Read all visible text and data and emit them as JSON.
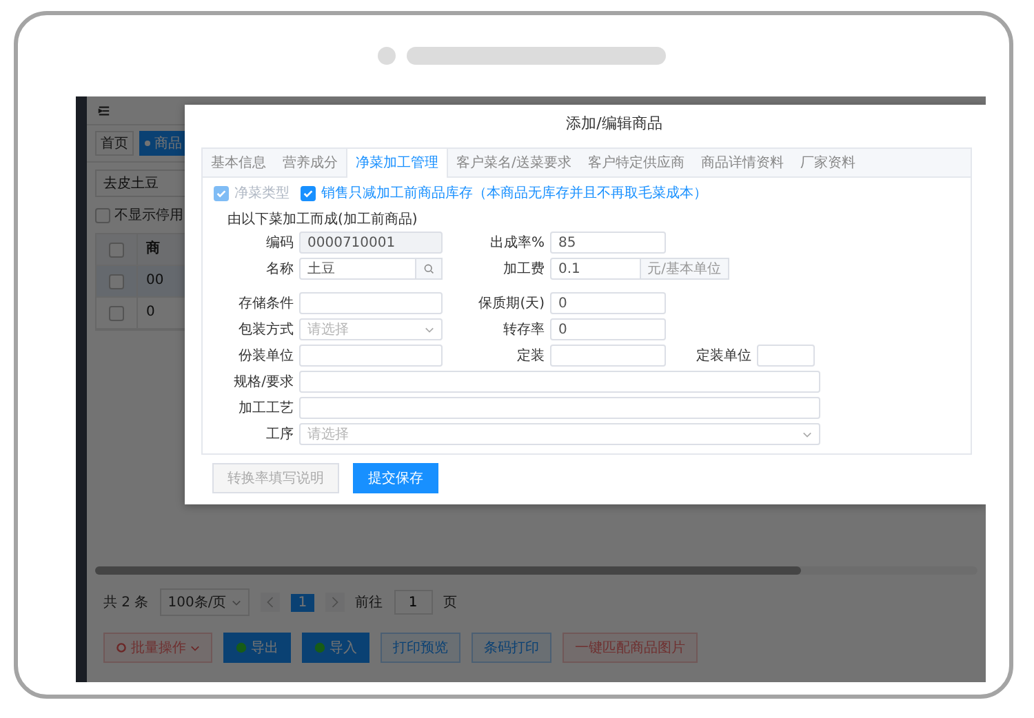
{
  "page": {
    "tabs": [
      {
        "label": "首页",
        "selected": false
      },
      {
        "label": "商品",
        "selected": true
      }
    ],
    "search": {
      "value": "去皮土豆"
    },
    "hide_disabled": {
      "label": "不显示停用",
      "checked": false
    },
    "table": {
      "select_all": false,
      "header": "商",
      "rows": [
        {
          "cell": "00",
          "selected": true,
          "checked": false
        },
        {
          "cell": "0",
          "selected": false,
          "checked": false
        }
      ]
    },
    "pagination": {
      "total": "共 2 条",
      "page_size": "100条/页",
      "pages": [
        {
          "label": "1",
          "selected": true
        }
      ],
      "goto_label": "前往",
      "goto_value": "1",
      "goto_suffix": "页"
    },
    "actions": [
      {
        "label": "批量操作",
        "kind": "danger-menu"
      },
      {
        "label": "导出",
        "kind": "primary"
      },
      {
        "label": "导入",
        "kind": "primary"
      },
      {
        "label": "打印预览",
        "kind": "plain"
      },
      {
        "label": "条码打印",
        "kind": "plain"
      },
      {
        "label": "一键匹配商品图片",
        "kind": "danger"
      }
    ]
  },
  "dialog": {
    "title": "添加/编辑商品",
    "tabs": [
      {
        "label": "基本信息",
        "selected": false
      },
      {
        "label": "营养成分",
        "selected": false
      },
      {
        "label": "净菜加工管理",
        "selected": true
      },
      {
        "label": "客户菜名/送菜要求",
        "selected": false
      },
      {
        "label": "客户特定供应商",
        "selected": false
      },
      {
        "label": "商品详情资料",
        "selected": false
      },
      {
        "label": "厂家资料",
        "selected": false
      }
    ],
    "checks": [
      {
        "label": "净菜类型",
        "checked": true,
        "disabled": true
      },
      {
        "label": "销售只减加工前商品库存（本商品无库存并且不再取毛菜成本）",
        "checked": true,
        "disabled": false
      }
    ],
    "section_title": "由以下菜加工而成(加工前商品)",
    "rows": [
      {
        "fields": [
          {
            "label": "编码",
            "kind": "readonly",
            "value": "0000710001"
          },
          {
            "label": "出成率%",
            "kind": "text",
            "value": "85"
          }
        ]
      },
      {
        "fields": [
          {
            "label": "名称",
            "kind": "lookup",
            "value": "土豆"
          },
          {
            "label": "加工费",
            "kind": "addon",
            "value": "0.1",
            "suffix": "元/基本单位"
          }
        ]
      },
      {
        "spaced": true,
        "fields": [
          {
            "label": "存储条件",
            "kind": "text"
          },
          {
            "label": "保质期(天)",
            "kind": "text",
            "value": "0"
          }
        ]
      },
      {
        "fields": [
          {
            "label": "包装方式",
            "kind": "select",
            "placeholder": "请选择"
          },
          {
            "label": "转存率",
            "kind": "text",
            "value": "0"
          }
        ]
      },
      {
        "fields": [
          {
            "label": "份装单位",
            "kind": "text"
          },
          {
            "label": "定装",
            "kind": "text"
          },
          {
            "label": "定装单位",
            "kind": "text"
          }
        ]
      },
      {
        "fields": [
          {
            "label": "规格/要求",
            "kind": "text",
            "wide": true
          }
        ]
      },
      {
        "fields": [
          {
            "label": "加工工艺",
            "kind": "text",
            "wide": true
          }
        ]
      },
      {
        "fields": [
          {
            "label": "工序",
            "kind": "select",
            "placeholder": "请选择",
            "wide": true
          }
        ]
      }
    ],
    "buttons": [
      {
        "label": "转换率填写说明",
        "kind": "default"
      },
      {
        "label": "提交保存",
        "kind": "primary"
      }
    ]
  }
}
